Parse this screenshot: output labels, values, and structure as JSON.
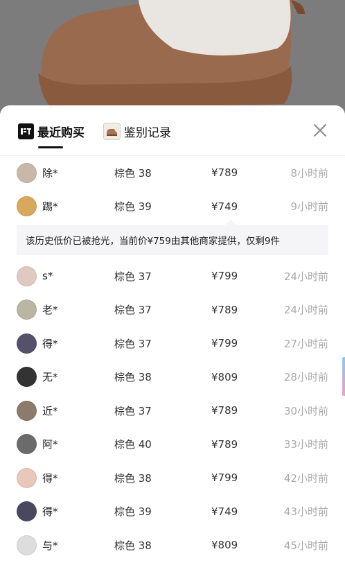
{
  "tabs": [
    {
      "label": "最近购买",
      "icon": "brand-logo-icon",
      "active": true
    },
    {
      "label": "鉴别记录",
      "icon": "shoe-thumbnail-icon",
      "active": false
    }
  ],
  "close_icon": "close-icon",
  "notice": "该历史低价已被抢光，当前价¥759由其他商家提供，仅剩9件",
  "records": [
    {
      "buyer": "除*",
      "spec": "棕色 38",
      "price": "¥789",
      "time": "8小时前",
      "avatar_color": "#c9b8a8"
    },
    {
      "buyer": "踢*",
      "spec": "棕色 39",
      "price": "¥749",
      "time": "9小时前",
      "avatar_color": "#d9a85c"
    },
    {
      "buyer": "s*",
      "spec": "棕色 37",
      "price": "¥799",
      "time": "24小时前",
      "avatar_color": "#e0c9c0"
    },
    {
      "buyer": "老*",
      "spec": "棕色 37",
      "price": "¥789",
      "time": "24小时前",
      "avatar_color": "#b9b6a4"
    },
    {
      "buyer": "得*",
      "spec": "棕色 37",
      "price": "¥799",
      "time": "27小时前",
      "avatar_color": "#55516a"
    },
    {
      "buyer": "无*",
      "spec": "棕色 38",
      "price": "¥809",
      "time": "28小时前",
      "avatar_color": "#333333"
    },
    {
      "buyer": "近*",
      "spec": "棕色 37",
      "price": "¥789",
      "time": "30小时前",
      "avatar_color": "#8c7b6b"
    },
    {
      "buyer": "阿*",
      "spec": "棕色 40",
      "price": "¥789",
      "time": "33小时前",
      "avatar_color": "#6b6b6b"
    },
    {
      "buyer": "得*",
      "spec": "棕色 38",
      "price": "¥799",
      "time": "42小时前",
      "avatar_color": "#e8c8b8"
    },
    {
      "buyer": "得*",
      "spec": "棕色 39",
      "price": "¥749",
      "time": "43小时前",
      "avatar_color": "#4a4860"
    },
    {
      "buyer": "与*",
      "spec": "棕色 38",
      "price": "¥809",
      "time": "45小时前",
      "avatar_color": "#dddddd"
    }
  ]
}
